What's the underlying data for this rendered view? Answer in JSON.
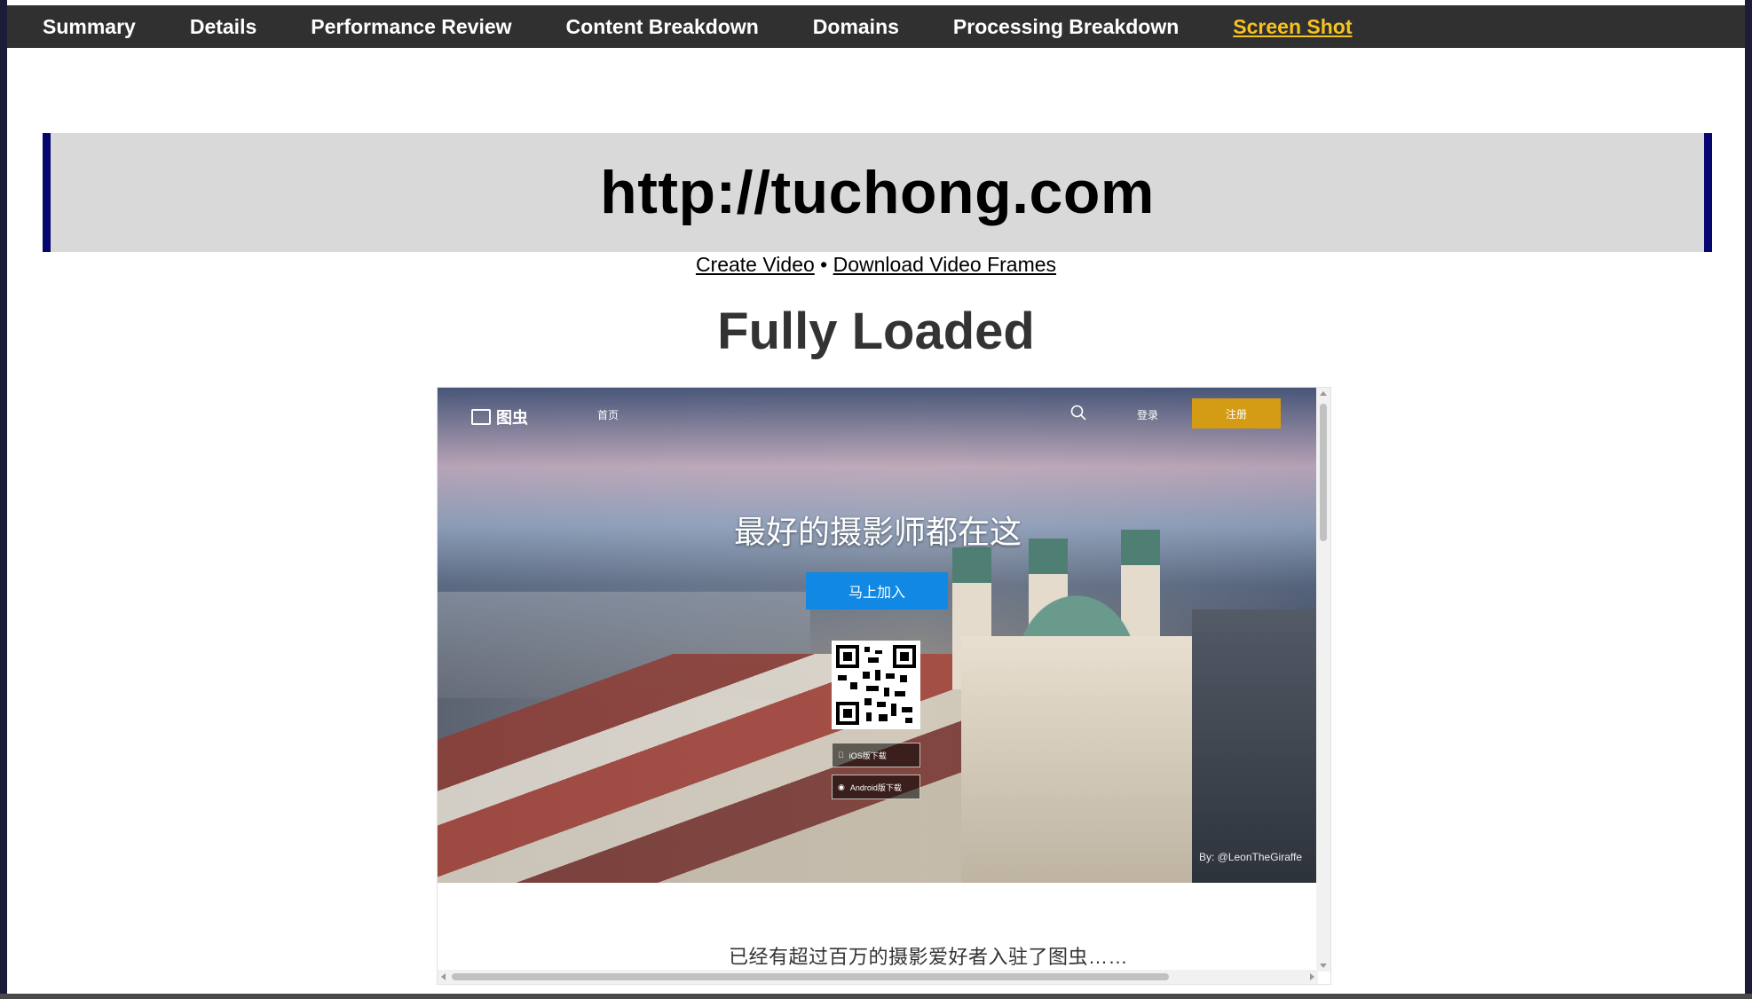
{
  "nav": {
    "items": [
      {
        "label": "Summary"
      },
      {
        "label": "Details"
      },
      {
        "label": "Performance Review"
      },
      {
        "label": "Content Breakdown"
      },
      {
        "label": "Domains"
      },
      {
        "label": "Processing Breakdown"
      },
      {
        "label": "Screen Shot",
        "active": true
      }
    ]
  },
  "url_banner": {
    "url": "http://tuchong.com"
  },
  "links": {
    "create_video": "Create Video",
    "separator": "•",
    "download_frames": "Download Video Frames"
  },
  "section_title": "Fully Loaded",
  "screenshot": {
    "logo_text": "图虫",
    "home_link": "首页",
    "login_link": "登录",
    "register_button": "注册",
    "hero_title": "最好的摄影师都在这",
    "join_button": "马上加入",
    "ios_download": "iOS版下载",
    "android_download": "Android版下载",
    "photo_credit": "By: @LeonTheGiraffe",
    "below_text": "已经有超过百万的摄影爱好者入驻了图虫……"
  },
  "colors": {
    "nav_bg": "#303030",
    "nav_active": "#f6c21e",
    "banner_bg": "#d9d9d9",
    "banner_border": "#06066f",
    "register_btn": "#d49b14",
    "join_btn": "#1189e4"
  }
}
